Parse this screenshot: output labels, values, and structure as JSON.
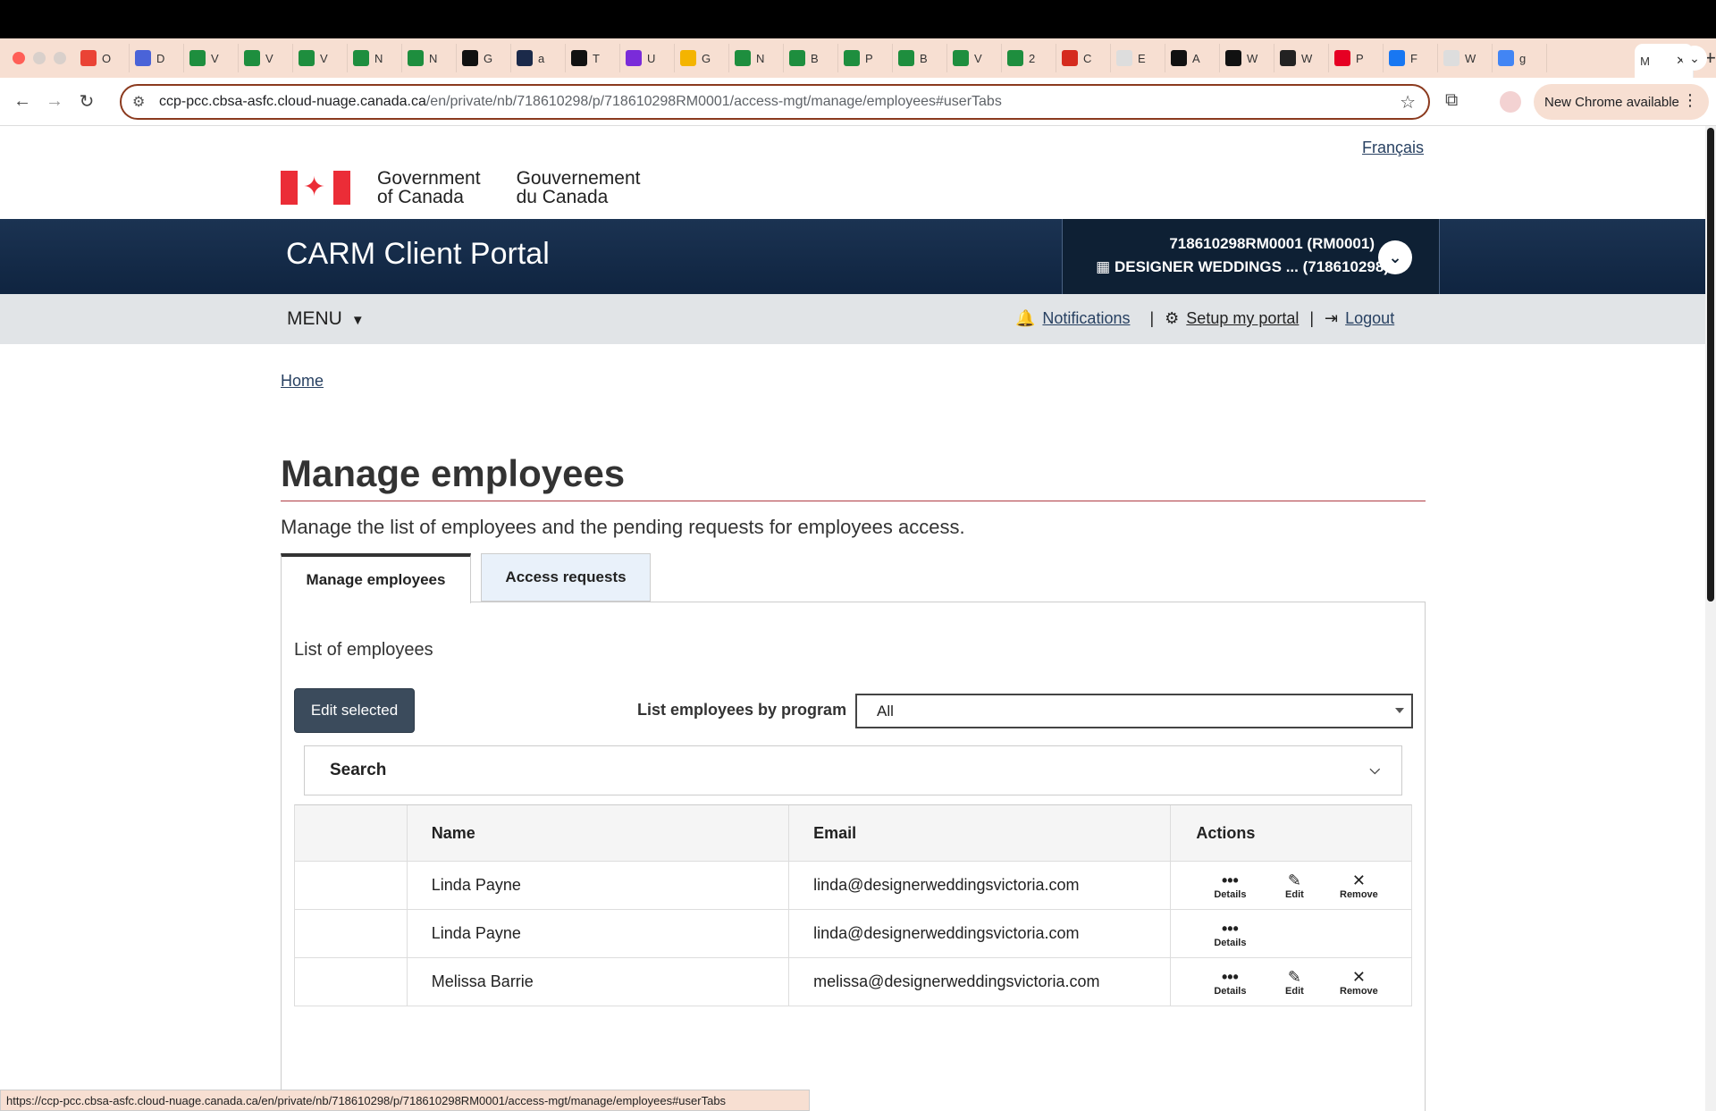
{
  "browser": {
    "tabs": [
      {
        "icon": "gmail-icon",
        "label": "O",
        "color": "#ea4335"
      },
      {
        "icon": "chat-icon",
        "label": "D",
        "color": "#4a63d8"
      },
      {
        "icon": "sheets-icon",
        "label": "V",
        "color": "#1e8e3e"
      },
      {
        "icon": "sheets-icon",
        "label": "V",
        "color": "#1e8e3e"
      },
      {
        "icon": "sheets-icon",
        "label": "V",
        "color": "#1e8e3e"
      },
      {
        "icon": "sheets-icon",
        "label": "N",
        "color": "#1e8e3e"
      },
      {
        "icon": "sheets-icon",
        "label": "N",
        "color": "#1e8e3e"
      },
      {
        "icon": "tv-icon",
        "label": "G",
        "color": "#111111"
      },
      {
        "icon": "check-icon",
        "label": "a",
        "color": "#1b2a4a"
      },
      {
        "icon": "doc-icon",
        "label": "T",
        "color": "#111111"
      },
      {
        "icon": "sk-icon",
        "label": "U",
        "color": "#7a2bd9"
      },
      {
        "icon": "drive-icon",
        "label": "G",
        "color": "#f4b400"
      },
      {
        "icon": "sheets-icon",
        "label": "N",
        "color": "#1e8e3e"
      },
      {
        "icon": "sheets-icon",
        "label": "B",
        "color": "#1e8e3e"
      },
      {
        "icon": "sheets-icon",
        "label": "P",
        "color": "#1e8e3e"
      },
      {
        "icon": "sheets-icon",
        "label": "B",
        "color": "#1e8e3e"
      },
      {
        "icon": "sheets-icon",
        "label": "V",
        "color": "#1e8e3e"
      },
      {
        "icon": "sheets-icon",
        "label": "2",
        "color": "#1e8e3e"
      },
      {
        "icon": "maple-leaf-icon",
        "label": "C",
        "color": "#d52b1e"
      },
      {
        "icon": "blank-icon",
        "label": "E",
        "color": "#dddddd"
      },
      {
        "icon": "amazon-icon",
        "label": "A",
        "color": "#111111"
      },
      {
        "icon": "amazon-icon",
        "label": "W",
        "color": "#111111"
      },
      {
        "icon": "circle-icon",
        "label": "W",
        "color": "#222222"
      },
      {
        "icon": "pinterest-icon",
        "label": "P",
        "color": "#e60023"
      },
      {
        "icon": "facebook-icon",
        "label": "F",
        "color": "#1877f2"
      },
      {
        "icon": "blank-icon",
        "label": "W",
        "color": "#dddddd"
      },
      {
        "icon": "google-icon",
        "label": "g",
        "color": "#4285f4"
      }
    ],
    "active_tab_label": "M",
    "url_host": "ccp-pcc.cbsa-asfc.cloud-nuage.canada.ca",
    "url_path": "/en/private/nb/718610298/p/718610298RM0001/access-mgt/manage/employees#userTabs",
    "new_chrome": "New Chrome available",
    "status_url": "https://ccp-pcc.cbsa-asfc.cloud-nuage.canada.ca/en/private/nb/718610298/p/718610298RM0001/access-mgt/manage/employees#userTabs"
  },
  "header": {
    "language_link": "Français",
    "goc_en_line1": "Government",
    "goc_en_line2": "of Canada",
    "goc_fr_line1": "Gouvernement",
    "goc_fr_line2": "du Canada",
    "app_title": "CARM Client Portal",
    "account_line1": "718610298RM0001 (RM0001)",
    "account_line2": "DESIGNER WEDDINGS ...  (718610298)",
    "menu_label": "MENU",
    "notifications": "Notifications",
    "setup": "Setup my portal",
    "logout": "Logout",
    "sep": "|"
  },
  "main": {
    "breadcrumb_home": "Home",
    "title": "Manage employees",
    "lead": "Manage the list of employees and the pending requests for employees access.",
    "tabs": [
      {
        "label": "Manage employees"
      },
      {
        "label": "Access requests"
      }
    ],
    "panel_heading": "List of employees",
    "edit_selected": "Edit selected",
    "program_label": "List employees by program",
    "program_value": "All",
    "search_label": "Search",
    "table": {
      "headers": [
        "",
        "Name",
        "Email",
        "Actions"
      ],
      "rows": [
        {
          "name": "Linda Payne",
          "email": "linda@designerweddingsvictoria.com",
          "actions": [
            "Details",
            "Edit",
            "Remove"
          ]
        },
        {
          "name": "Linda Payne",
          "email": "linda@designerweddingsvictoria.com",
          "actions": [
            "Details"
          ]
        },
        {
          "name": "Melissa Barrie",
          "email": "melissa@designerweddingsvictoria.com",
          "actions": [
            "Details",
            "Edit",
            "Remove"
          ]
        }
      ],
      "action_labels": {
        "details": "Details",
        "edit": "Edit",
        "remove": "Remove"
      }
    }
  }
}
